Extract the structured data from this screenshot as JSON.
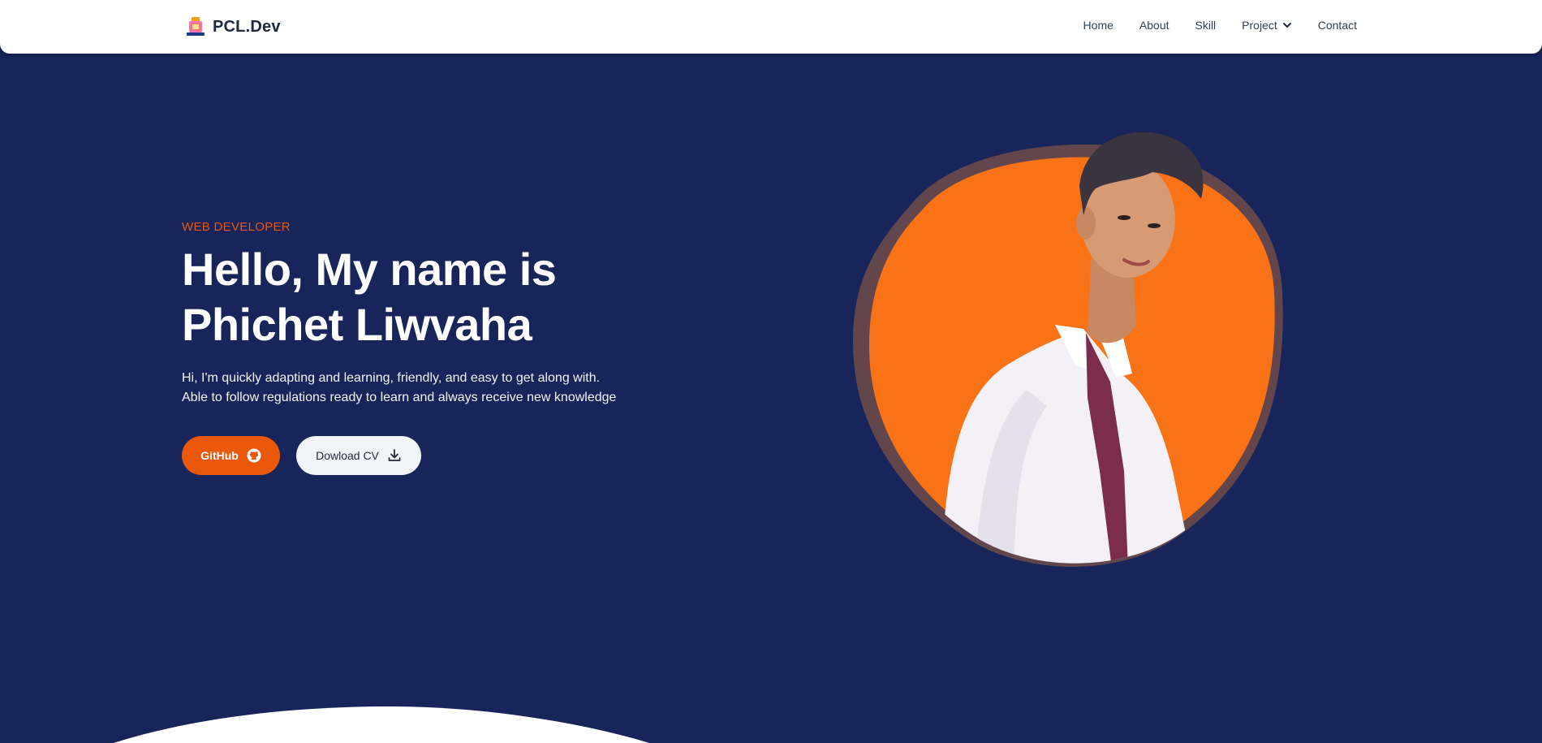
{
  "nav": {
    "brand": "PCL.Dev",
    "links": [
      "Home",
      "About",
      "Skill",
      "Project",
      "Contact"
    ]
  },
  "hero": {
    "eyebrow": "WEB DEVELOPER",
    "headline_line1": "Hello, My name is",
    "headline_line2": "Phichet Liwvaha",
    "intro_line1": "Hi, I'm quickly adapting and learning, friendly, and easy to get along with.",
    "intro_line2": "Able to follow regulations ready to learn and always receive new knowledge",
    "github_label": "GitHub",
    "cv_label": "Dowload CV"
  },
  "icons": {
    "brand": "laptop-logo-icon",
    "project_dropdown": "chevron-down-icon",
    "github": "github-icon",
    "download": "download-icon"
  },
  "colors": {
    "background": "#18255a",
    "accent": "#ea580c",
    "blob": "#f97316",
    "blob_shadow": "#6b4a4a",
    "navbar": "#ffffff"
  }
}
